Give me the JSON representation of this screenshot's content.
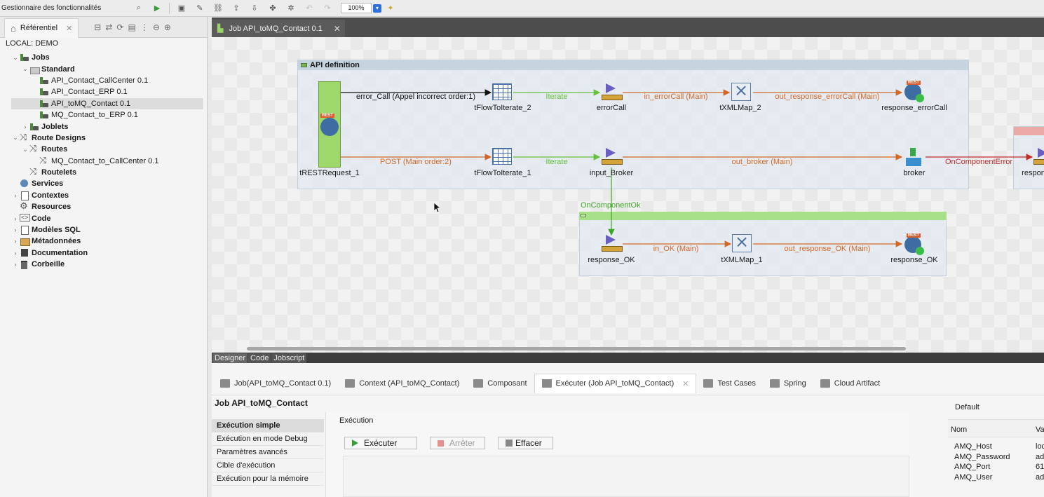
{
  "topbar": {
    "app_label": "Gestionnaire des fonctionnalités",
    "zoom": "100%"
  },
  "repository": {
    "tab_label": "Référentiel",
    "local_label": "LOCAL: DEMO",
    "tree": [
      {
        "label": "Jobs",
        "indent": 0,
        "expanded": true,
        "bold": true,
        "icon": "job-folder-icon"
      },
      {
        "label": "Standard",
        "indent": 1,
        "expanded": true,
        "bold": true,
        "icon": "folder-icon"
      },
      {
        "label": "API_Contact_CallCenter 0.1",
        "indent": 2,
        "icon": "job-icon"
      },
      {
        "label": "API_Contact_ERP 0.1",
        "indent": 2,
        "icon": "job-icon"
      },
      {
        "label": "API_toMQ_Contact 0.1",
        "indent": 2,
        "icon": "job-icon",
        "selected": true
      },
      {
        "label": "MQ_Contact_to_ERP 0.1",
        "indent": 2,
        "icon": "job-icon"
      },
      {
        "label": "Joblets",
        "indent": 1,
        "collapsed": true,
        "bold": true,
        "icon": "joblet-icon"
      },
      {
        "label": "Route Designs",
        "indent": 0,
        "expanded": true,
        "bold": true,
        "icon": "route-icon"
      },
      {
        "label": "Routes",
        "indent": 1,
        "expanded": true,
        "bold": true,
        "icon": "route-icon"
      },
      {
        "label": "MQ_Contact_to_CallCenter 0.1",
        "indent": 2,
        "icon": "route-icon"
      },
      {
        "label": "Routelets",
        "indent": 1,
        "bold": true,
        "icon": "route-icon"
      },
      {
        "label": "Services",
        "indent": 0,
        "bold": true,
        "icon": "globe-icon"
      },
      {
        "label": "Contextes",
        "indent": 0,
        "collapsed": true,
        "bold": true,
        "icon": "context-icon"
      },
      {
        "label": "Resources",
        "indent": 0,
        "bold": true,
        "icon": "gear-icon"
      },
      {
        "label": "Code",
        "indent": 0,
        "collapsed": true,
        "bold": true,
        "icon": "code-icon"
      },
      {
        "label": "Modèles SQL",
        "indent": 0,
        "collapsed": true,
        "bold": true,
        "icon": "sql-icon"
      },
      {
        "label": "Métadonnées",
        "indent": 0,
        "collapsed": true,
        "bold": true,
        "icon": "metadata-icon"
      },
      {
        "label": "Documentation",
        "indent": 0,
        "collapsed": true,
        "bold": true,
        "icon": "documentation-icon"
      },
      {
        "label": "Corbeille",
        "indent": 0,
        "collapsed": true,
        "bold": true,
        "icon": "trash-icon"
      }
    ]
  },
  "editor": {
    "tab_label": "Job API_toMQ_Contact 0.1"
  },
  "canvas": {
    "subjob_title": "API definition",
    "components": {
      "rest_request": "tRESTRequest_1",
      "flow_iterate_2": "tFlowToIterate_2",
      "error_call": "errorCall",
      "xmlmap_2": "tXMLMap_2",
      "response_error_call": "response_errorCall",
      "flow_iterate_1": "tFlowToIterate_1",
      "input_broker": "input_Broker",
      "broker": "broker",
      "response_partial": "respon",
      "response_ok_in": "response_OK",
      "xmlmap_1": "tXMLMap_1",
      "response_ok_out": "response_OK"
    },
    "flows": {
      "error_call": "error_Call (Appel incorrect order:1)",
      "iterate_top": "Iterate",
      "in_error_call": "in_errorCall (Main)",
      "out_response_error_call": "out_response_errorCall (Main)",
      "post": "POST (Main order:2)",
      "iterate_mid": "Iterate",
      "out_broker": "out_broker (Main)",
      "on_component_error": "OnComponentError",
      "on_component_ok": "OnComponentOk",
      "in_ok": "in_OK (Main)",
      "out_response_ok": "out_response_OK (Main)"
    },
    "rest_badge": "REST"
  },
  "view_tabs": [
    "Designer",
    "Code",
    "Jobscript"
  ],
  "bottom": {
    "tabs": [
      {
        "label": "Job(API_toMQ_Contact 0.1)",
        "icon": "job-icon"
      },
      {
        "label": "Context (API_toMQ_Contact)",
        "icon": "context-icon"
      },
      {
        "label": "Composant",
        "icon": "component-icon"
      },
      {
        "label": "Exécuter (Job API_toMQ_Contact)",
        "icon": "run-icon",
        "active": true
      },
      {
        "label": "Test Cases",
        "icon": "test-cases-icon"
      },
      {
        "label": "Spring",
        "icon": "spring-icon"
      },
      {
        "label": "Cloud Artifact",
        "icon": "cloud-artifact-icon"
      }
    ],
    "job_title": "Job API_toMQ_Contact",
    "side_menu": [
      "Exécution simple",
      "Exécution en mode Debug",
      "Paramètres avancés",
      "Cible d'exécution",
      "Exécution pour la mémoire"
    ],
    "exec_label": "Exécution",
    "buttons": {
      "run": "Exécuter",
      "stop": "Arrêter",
      "clear": "Effacer"
    },
    "context": {
      "default_label": "Default",
      "col_name": "Nom",
      "col_value": "Va",
      "rows": [
        {
          "name": "AMQ_Host",
          "value": "loc"
        },
        {
          "name": "AMQ_Password",
          "value": "ad"
        },
        {
          "name": "AMQ_Port",
          "value": "61"
        },
        {
          "name": "AMQ_User",
          "value": "ad"
        }
      ]
    }
  }
}
